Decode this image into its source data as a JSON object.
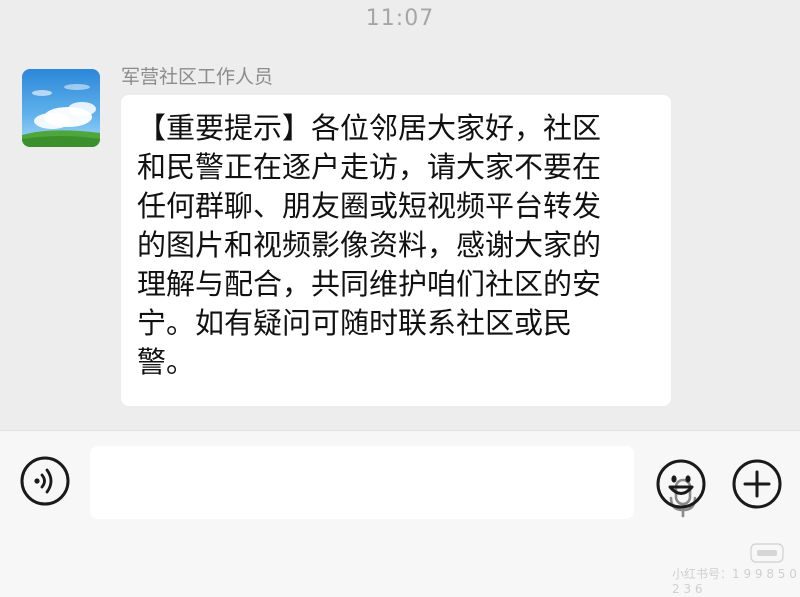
{
  "status": {
    "time": "11:07"
  },
  "message": {
    "sender_name": "军营社区工作人员",
    "text": "【重要提示】各位邻居大家好，社区\n和民警正在逐户走访，请大家不要在\n任何群聊、朋友圈或短视频平台转发\n的图片和视频影像资料，感谢大家的\n理解与配合，共同维护咱们社区的安\n宁。如有疑问可随时联系社区或民\n警。",
    "avatar": "sky-avatar"
  },
  "input_bar": {
    "input_value": "",
    "icons": {
      "voice": "voice-icon",
      "mic": "mic-icon",
      "emoji": "emoji-icon",
      "add": "plus-icon"
    }
  },
  "watermark": {
    "text": "小红书号：1 9 9 8 5 0 2 3 6"
  },
  "colors": {
    "background": "#ededed",
    "bubble": "#ffffff",
    "text": "#111111",
    "meta_text": "#a6a6a6"
  }
}
